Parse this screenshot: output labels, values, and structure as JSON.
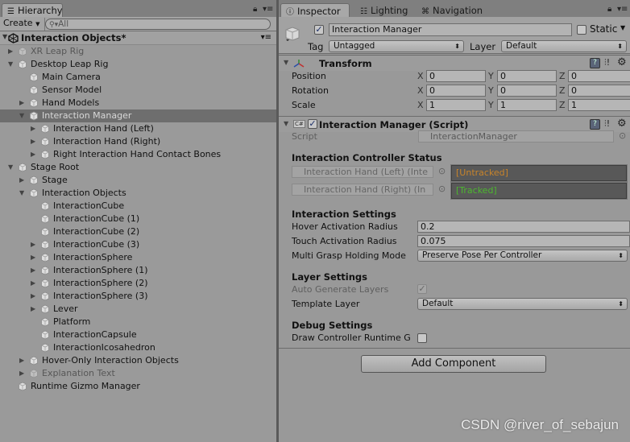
{
  "hierarchy": {
    "tab_label": "Hierarchy",
    "create_label": "Create",
    "search_placeholder": "All",
    "scene_title": "Interaction Objects*",
    "items": [
      {
        "label": "XR Leap Rig",
        "depth": 0,
        "arrow": "collapsed",
        "dim": true
      },
      {
        "label": "Desktop Leap Rig",
        "depth": 0,
        "arrow": "expanded"
      },
      {
        "label": "Main Camera",
        "depth": 1,
        "arrow": "none"
      },
      {
        "label": "Sensor Model",
        "depth": 1,
        "arrow": "none"
      },
      {
        "label": "Hand Models",
        "depth": 1,
        "arrow": "collapsed"
      },
      {
        "label": "Interaction Manager",
        "depth": 1,
        "arrow": "expanded",
        "selected": true
      },
      {
        "label": "Interaction Hand (Left)",
        "depth": 2,
        "arrow": "collapsed"
      },
      {
        "label": "Interaction Hand (Right)",
        "depth": 2,
        "arrow": "collapsed"
      },
      {
        "label": "Right Interaction Hand Contact Bones",
        "depth": 2,
        "arrow": "collapsed"
      },
      {
        "label": "Stage Root",
        "depth": 0,
        "arrow": "expanded"
      },
      {
        "label": "Stage",
        "depth": 1,
        "arrow": "collapsed"
      },
      {
        "label": "Interaction Objects",
        "depth": 1,
        "arrow": "expanded"
      },
      {
        "label": "InteractionCube",
        "depth": 2,
        "arrow": "none"
      },
      {
        "label": "InteractionCube (1)",
        "depth": 2,
        "arrow": "none"
      },
      {
        "label": "InteractionCube (2)",
        "depth": 2,
        "arrow": "none"
      },
      {
        "label": "InteractionCube (3)",
        "depth": 2,
        "arrow": "collapsed"
      },
      {
        "label": "InteractionSphere",
        "depth": 2,
        "arrow": "collapsed"
      },
      {
        "label": "InteractionSphere (1)",
        "depth": 2,
        "arrow": "collapsed"
      },
      {
        "label": "InteractionSphere (2)",
        "depth": 2,
        "arrow": "collapsed"
      },
      {
        "label": "InteractionSphere (3)",
        "depth": 2,
        "arrow": "collapsed"
      },
      {
        "label": "Lever",
        "depth": 2,
        "arrow": "collapsed"
      },
      {
        "label": "Platform",
        "depth": 2,
        "arrow": "none"
      },
      {
        "label": "InteractionCapsule",
        "depth": 2,
        "arrow": "none"
      },
      {
        "label": "InteractionIcosahedron",
        "depth": 2,
        "arrow": "none"
      },
      {
        "label": "Hover-Only Interaction Objects",
        "depth": 1,
        "arrow": "collapsed"
      },
      {
        "label": "Explanation Text",
        "depth": 1,
        "arrow": "collapsed",
        "dim": true
      },
      {
        "label": "Runtime Gizmo Manager",
        "depth": 0,
        "arrow": "none"
      }
    ]
  },
  "inspector": {
    "tabs": [
      {
        "label": "Inspector",
        "icon": "info-icon"
      },
      {
        "label": "Lighting",
        "icon": "lighting-icon"
      },
      {
        "label": "Navigation",
        "icon": "navigation-icon"
      }
    ],
    "object_name": "Interaction Manager",
    "active": true,
    "static_label": "Static",
    "static": false,
    "tag_label": "Tag",
    "tag_value": "Untagged",
    "layer_label": "Layer",
    "layer_value": "Default",
    "transform": {
      "title": "Transform",
      "rows": [
        {
          "label": "Position",
          "x": "0",
          "y": "0",
          "z": "0"
        },
        {
          "label": "Rotation",
          "x": "0",
          "y": "0",
          "z": "0"
        },
        {
          "label": "Scale",
          "x": "1",
          "y": "1",
          "z": "1"
        }
      ],
      "axis_x": "X",
      "axis_y": "Y",
      "axis_z": "Z"
    },
    "script_component": {
      "title": "Interaction Manager (Script)",
      "enabled": true,
      "script_label": "Script",
      "script_value": "InteractionManager",
      "controller_status_title": "Interaction Controller Status",
      "controllers": [
        {
          "ref": "Interaction Hand (Left) (Inte",
          "status": "[Untracked]",
          "status_color": "#c8842a"
        },
        {
          "ref": "Interaction Hand (Right) (In",
          "status": "[Tracked]",
          "status_color": "#4cb82e"
        }
      ],
      "interaction_settings_title": "Interaction Settings",
      "hover_label": "Hover Activation Radius",
      "hover_value": "0.2",
      "touch_label": "Touch Activation Radius",
      "touch_value": "0.075",
      "grasp_label": "Multi Grasp Holding Mode",
      "grasp_value": "Preserve Pose Per Controller",
      "layer_settings_title": "Layer Settings",
      "auto_layers_label": "Auto Generate Layers",
      "auto_layers": true,
      "template_layer_label": "Template Layer",
      "template_layer_value": "Default",
      "debug_settings_title": "Debug Settings",
      "draw_runtime_label": "Draw Controller Runtime G",
      "draw_runtime": false
    },
    "add_component_label": "Add Component"
  },
  "watermark": "CSDN @river_of_sebajun"
}
